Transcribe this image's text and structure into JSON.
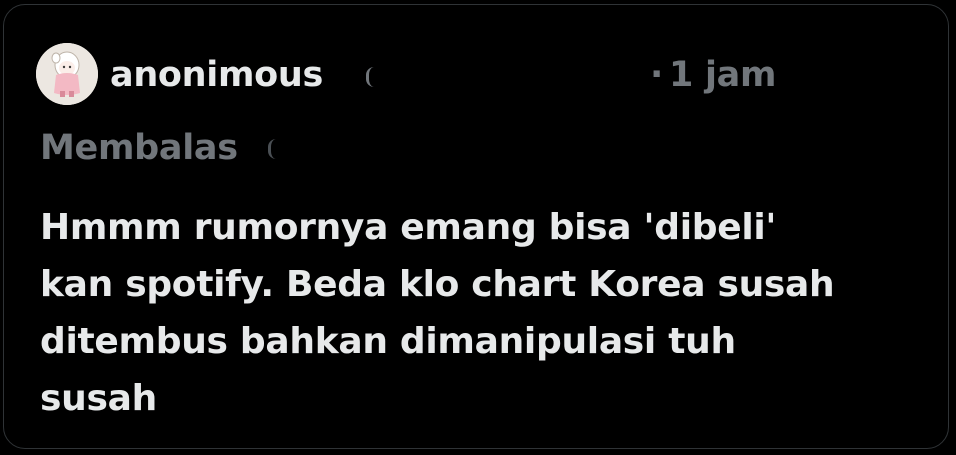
{
  "post": {
    "username": "anonimous",
    "time_separator": "·",
    "time": "1 jam",
    "replying_to_label": "Membalas",
    "text_lines": [
      "Hmmm rumornya emang bisa 'dibeli'",
      "kan spotify. Beda klo chart Korea susah",
      "ditembus bahkan dimanipulasi tuh",
      "susah"
    ]
  },
  "colors": {
    "background": "#000000",
    "primary_text": "#e7e9ea",
    "secondary_text": "#71767b",
    "border": "#2f3336"
  },
  "icons": {
    "avatar": "cartoon-character-avatar"
  }
}
